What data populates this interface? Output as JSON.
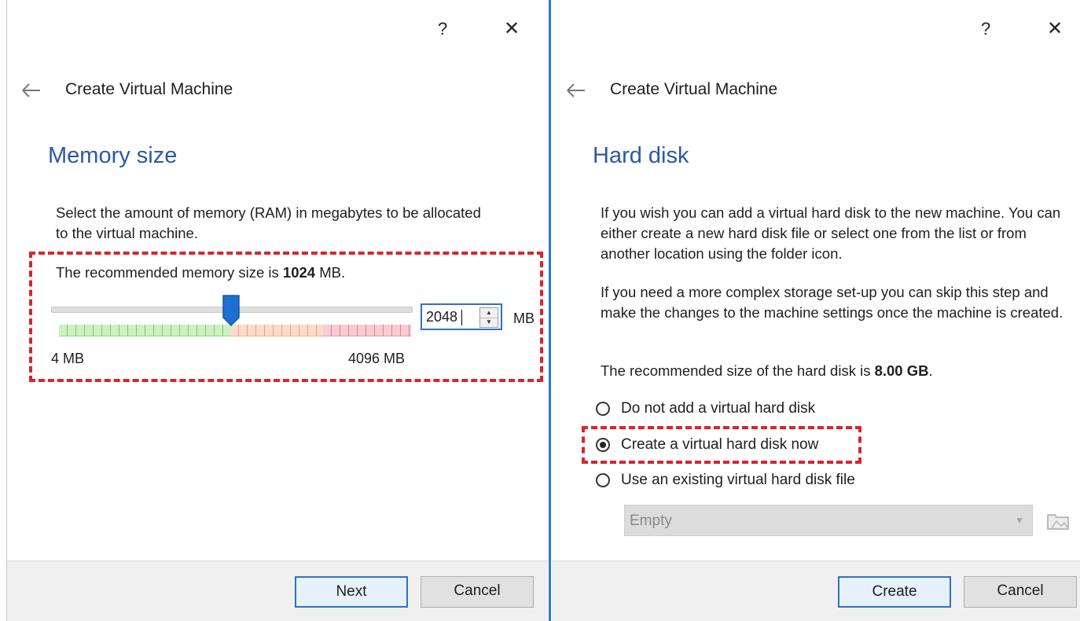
{
  "left_dialog": {
    "help_label": "?",
    "close_label": "✕",
    "window_title": "Create Virtual Machine",
    "heading": "Memory size",
    "description": "Select the amount of memory (RAM) in megabytes to be allocated to the virtual machine.",
    "recommended_prefix": "The recommended memory size is ",
    "recommended_value": "1024",
    "recommended_suffix": " MB.",
    "slider": {
      "value": 2048,
      "min_label": "4 MB",
      "max_label": "4096 MB"
    },
    "memory_input_value": "2048",
    "unit_label": "MB",
    "buttons": {
      "next": "Next",
      "cancel": "Cancel"
    }
  },
  "right_dialog": {
    "help_label": "?",
    "close_label": "✕",
    "window_title": "Create Virtual Machine",
    "heading": "Hard disk",
    "description_1": "If you wish you can add a virtual hard disk to the new machine. You can either create a new hard disk file or select one from the list or from another location using the folder icon.",
    "description_2": "If you need a more complex storage set-up you can skip this step and make the changes to the machine settings once the machine is created.",
    "recommended_prefix": "The recommended size of the hard disk is ",
    "recommended_value": "8.00 GB",
    "recommended_suffix": ".",
    "options": [
      {
        "label": "Do not add a virtual hard disk",
        "checked": false
      },
      {
        "label": "Create a virtual hard disk now",
        "checked": true
      },
      {
        "label": "Use an existing virtual hard disk file",
        "checked": false
      }
    ],
    "disk_select_value": "Empty",
    "buttons": {
      "create": "Create",
      "cancel": "Cancel"
    }
  },
  "colors": {
    "accent": "#2e72c9",
    "heading": "#2b58a8",
    "highlight": "#d8252b"
  },
  "icons": [
    "help-icon",
    "close-icon",
    "back-arrow-icon",
    "slider-thumb-icon",
    "folder-icon",
    "chevron-down-icon"
  ]
}
